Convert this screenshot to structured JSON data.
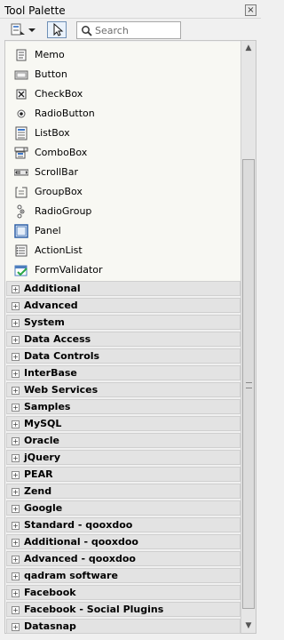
{
  "window": {
    "title": "Tool Palette",
    "close_glyph": "×"
  },
  "toolbar": {
    "palette_icon": "palette-menu-icon",
    "cursor_icon": "cursor-icon",
    "search": {
      "placeholder": "Search",
      "value": ""
    }
  },
  "components": [
    {
      "label": "Memo",
      "icon": "memo-icon"
    },
    {
      "label": "Button",
      "icon": "button-icon"
    },
    {
      "label": "CheckBox",
      "icon": "checkbox-icon"
    },
    {
      "label": "RadioButton",
      "icon": "radio-button-icon"
    },
    {
      "label": "ListBox",
      "icon": "listbox-icon"
    },
    {
      "label": "ComboBox",
      "icon": "combobox-icon"
    },
    {
      "label": "ScrollBar",
      "icon": "scrollbar-icon"
    },
    {
      "label": "GroupBox",
      "icon": "groupbox-icon"
    },
    {
      "label": "RadioGroup",
      "icon": "radio-group-icon"
    },
    {
      "label": "Panel",
      "icon": "panel-icon"
    },
    {
      "label": "ActionList",
      "icon": "action-list-icon"
    },
    {
      "label": "FormValidator",
      "icon": "form-validator-icon"
    }
  ],
  "categories": [
    {
      "label": "Additional",
      "expander": "+"
    },
    {
      "label": "Advanced",
      "expander": "+"
    },
    {
      "label": "System",
      "expander": "+"
    },
    {
      "label": "Data Access",
      "expander": "+"
    },
    {
      "label": "Data Controls",
      "expander": "+"
    },
    {
      "label": "InterBase",
      "expander": "+"
    },
    {
      "label": "Web Services",
      "expander": "+"
    },
    {
      "label": "Samples",
      "expander": "+"
    },
    {
      "label": "MySQL",
      "expander": "+"
    },
    {
      "label": "Oracle",
      "expander": "+"
    },
    {
      "label": "jQuery",
      "expander": "+"
    },
    {
      "label": "PEAR",
      "expander": "+"
    },
    {
      "label": "Zend",
      "expander": "+"
    },
    {
      "label": "Google",
      "expander": "+"
    },
    {
      "label": "Standard - qooxdoo",
      "expander": "+"
    },
    {
      "label": "Additional - qooxdoo",
      "expander": "+"
    },
    {
      "label": "Advanced - qooxdoo",
      "expander": "+"
    },
    {
      "label": "qadram software",
      "expander": "+"
    },
    {
      "label": "Facebook",
      "expander": "+"
    },
    {
      "label": "Facebook - Social Plugins",
      "expander": "+"
    },
    {
      "label": "Datasnap",
      "expander": "+"
    }
  ],
  "scrollbar": {
    "position_fraction": 0.21,
    "visible_fraction": 0.78
  },
  "colors": {
    "background": "#f0f0f0",
    "component_area": "#f8f8f3",
    "category_bar": "#e3e3e3",
    "selected_tool_border": "#6f8fb6"
  }
}
